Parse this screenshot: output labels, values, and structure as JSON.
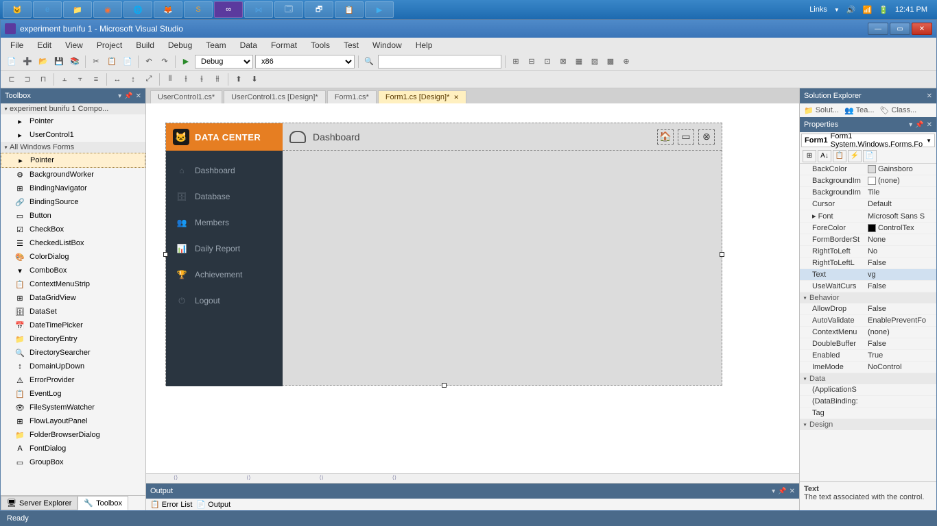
{
  "taskbar": {
    "links": "Links",
    "time": "12:41 PM"
  },
  "window": {
    "title": "experiment bunifu 1 - Microsoft Visual Studio"
  },
  "menu": [
    "File",
    "Edit",
    "View",
    "Project",
    "Build",
    "Debug",
    "Team",
    "Data",
    "Format",
    "Tools",
    "Test",
    "Window",
    "Help"
  ],
  "toolbar": {
    "config": "Debug",
    "platform": "x86"
  },
  "toolbox": {
    "title": "Toolbox",
    "group1": "experiment bunifu 1 Compo...",
    "group1_items": [
      "Pointer",
      "UserControl1"
    ],
    "group2": "All Windows Forms",
    "items": [
      "Pointer",
      "BackgroundWorker",
      "BindingNavigator",
      "BindingSource",
      "Button",
      "CheckBox",
      "CheckedListBox",
      "ColorDialog",
      "ComboBox",
      "ContextMenuStrip",
      "DataGridView",
      "DataSet",
      "DateTimePicker",
      "DirectoryEntry",
      "DirectorySearcher",
      "DomainUpDown",
      "ErrorProvider",
      "EventLog",
      "FileSystemWatcher",
      "FlowLayoutPanel",
      "FolderBrowserDialog",
      "FontDialog",
      "GroupBox"
    ],
    "selected_index": 0,
    "tabs": {
      "server": "Server Explorer",
      "toolbox": "Toolbox"
    }
  },
  "docs": {
    "tabs": [
      "UserControl1.cs*",
      "UserControl1.cs [Design]*",
      "Form1.cs*",
      "Form1.cs [Design]*"
    ],
    "active": 3
  },
  "form": {
    "brand": "Data Center",
    "dashboard_label": "Dashboard",
    "menu": [
      "Dashboard",
      "Database",
      "Members",
      "Daily Report",
      "Achievement",
      "Logout"
    ]
  },
  "output": {
    "title": "Output",
    "tabs": [
      "Error List",
      "Output"
    ]
  },
  "solution_explorer": {
    "title": "Solution Explorer",
    "items": [
      "Solut...",
      "Tea...",
      "Class..."
    ]
  },
  "properties": {
    "title": "Properties",
    "object": "Form1 System.Windows.Forms.Fo",
    "categories": {
      "appearance": "",
      "behavior": "Behavior",
      "data": "Data",
      "design": "Design"
    },
    "rows": [
      {
        "name": "BackColor",
        "value": "Gainsboro",
        "swatch": "#dcdcdc"
      },
      {
        "name": "BackgroundIm",
        "value": "(none)",
        "swatch": "#ffffff"
      },
      {
        "name": "BackgroundIm",
        "value": "Tile"
      },
      {
        "name": "Cursor",
        "value": "Default"
      },
      {
        "name": "Font",
        "value": "Microsoft Sans S",
        "expand": true
      },
      {
        "name": "ForeColor",
        "value": "ControlTex",
        "swatch": "#000000"
      },
      {
        "name": "FormBorderSt",
        "value": "None"
      },
      {
        "name": "RightToLeft",
        "value": "No"
      },
      {
        "name": "RightToLeftL",
        "value": "False"
      },
      {
        "name": "Text",
        "value": "vg",
        "selected": true
      },
      {
        "name": "UseWaitCurs",
        "value": "False"
      }
    ],
    "behavior_rows": [
      {
        "name": "AllowDrop",
        "value": "False"
      },
      {
        "name": "AutoValidate",
        "value": "EnablePreventFo"
      },
      {
        "name": "ContextMenu",
        "value": "(none)"
      },
      {
        "name": "DoubleBuffer",
        "value": "False"
      },
      {
        "name": "Enabled",
        "value": "True"
      },
      {
        "name": "ImeMode",
        "value": "NoControl"
      }
    ],
    "data_rows": [
      {
        "name": "(ApplicationS",
        "value": ""
      },
      {
        "name": "(DataBinding:",
        "value": ""
      },
      {
        "name": "Tag",
        "value": ""
      }
    ],
    "help": {
      "title": "Text",
      "desc": "The text associated with the control."
    }
  },
  "status": "Ready"
}
